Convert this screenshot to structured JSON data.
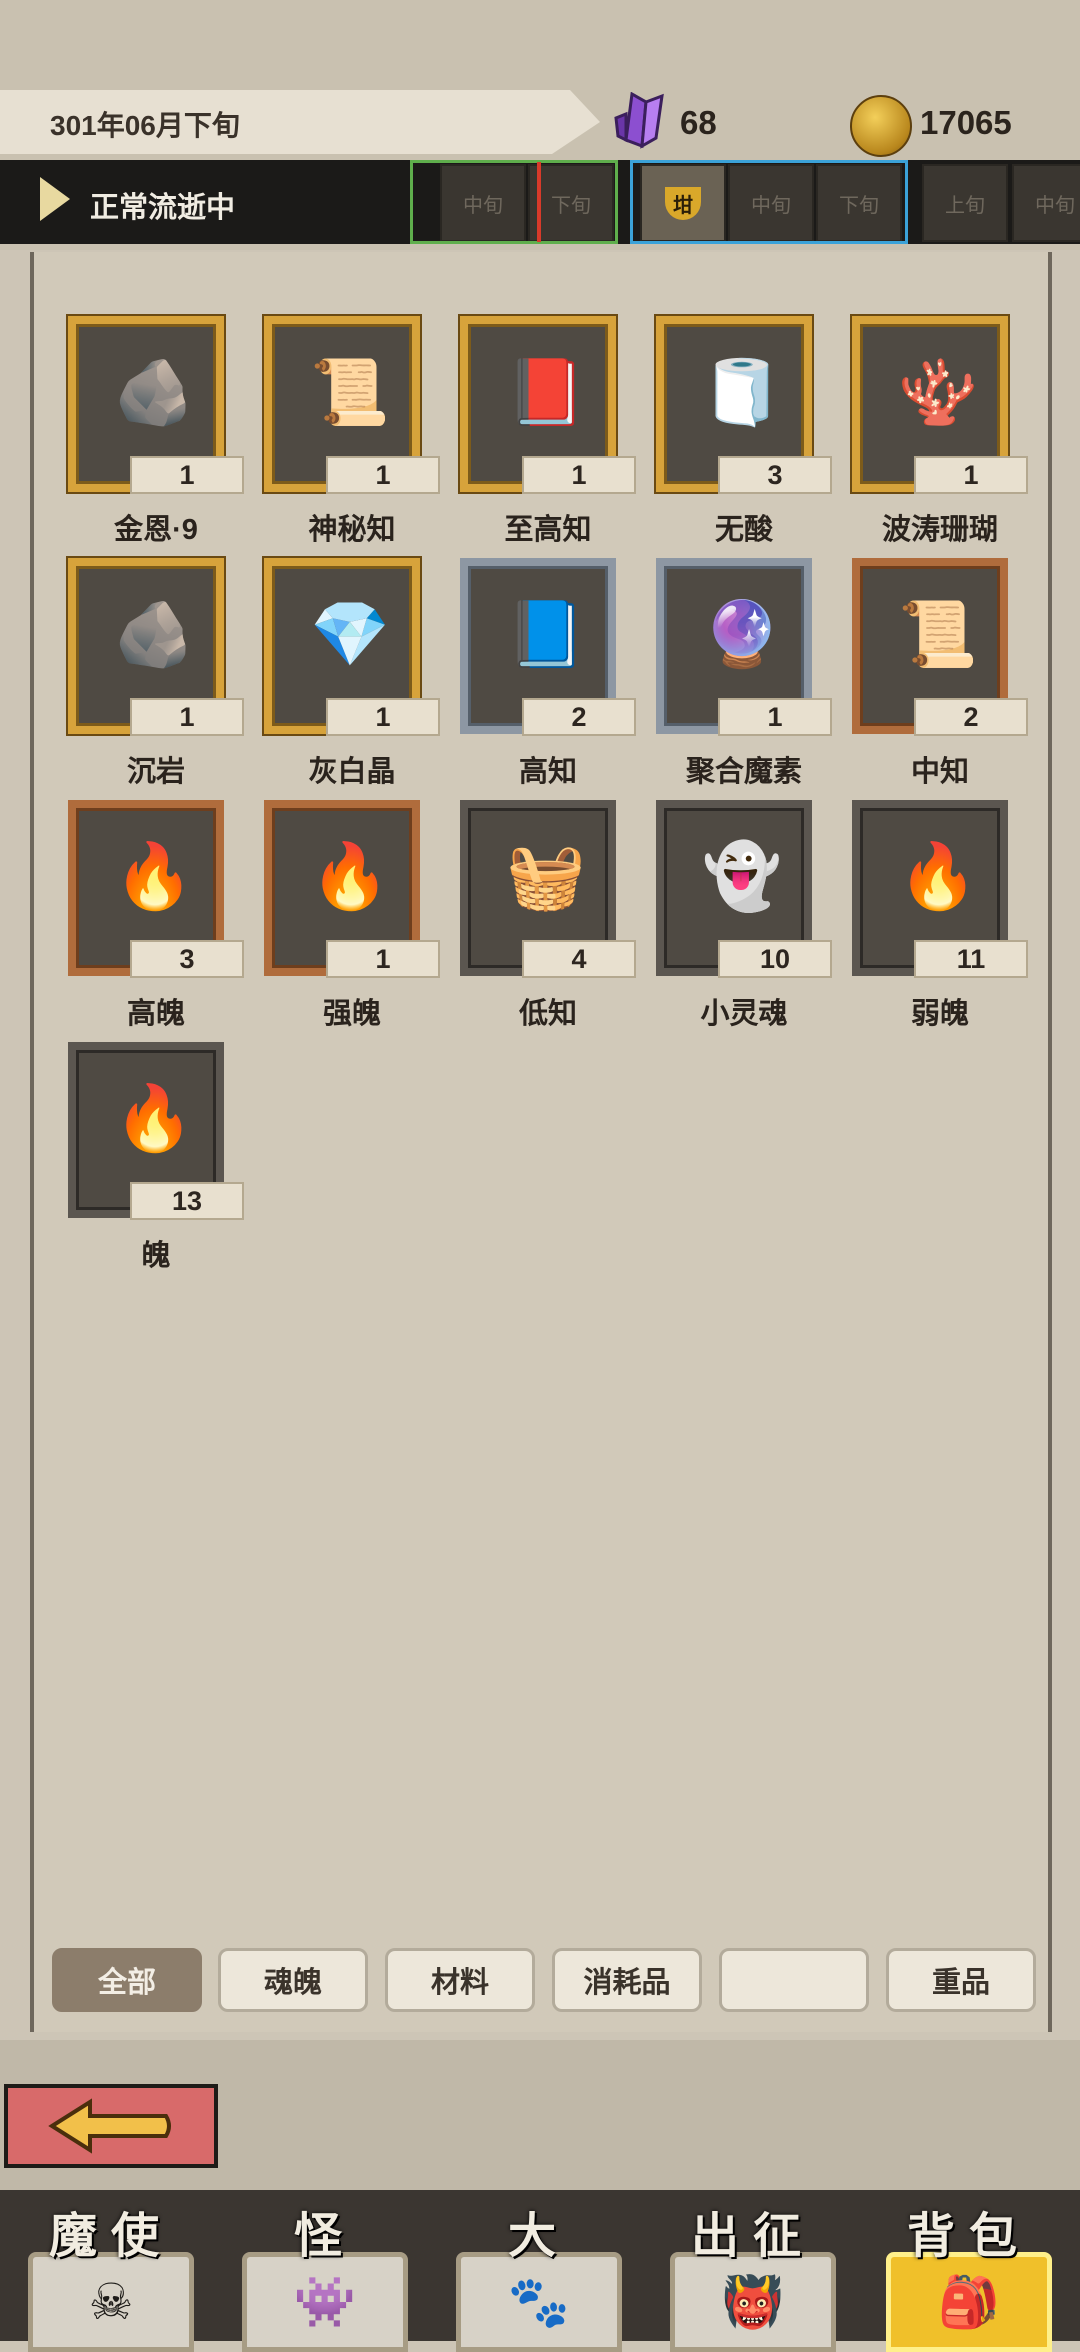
{
  "header": {
    "date": "301年06月下旬",
    "crystal_count": "68",
    "coin_count": "17065",
    "flow_status": "正常流逝中",
    "periods": [
      {
        "label": "中旬"
      },
      {
        "label": "下旬"
      },
      {
        "label": "坩"
      },
      {
        "label": "中旬"
      },
      {
        "label": "下旬"
      },
      {
        "label": "上旬"
      },
      {
        "label": "中旬"
      }
    ]
  },
  "inventory": {
    "items": [
      {
        "name": "金恩·9",
        "qty": "1",
        "rarity": "gold",
        "icon": "rune-stone-icon"
      },
      {
        "name": "神秘知",
        "qty": "1",
        "rarity": "gold",
        "icon": "tablet-icon"
      },
      {
        "name": "至高知",
        "qty": "1",
        "rarity": "gold",
        "icon": "tome-icon"
      },
      {
        "name": "无酸",
        "qty": "3",
        "rarity": "gold",
        "icon": "scroll-icon"
      },
      {
        "name": "波涛珊瑚",
        "qty": "1",
        "rarity": "gold",
        "icon": "coral-icon"
      },
      {
        "name": "沉岩",
        "qty": "1",
        "rarity": "gold",
        "icon": "rock-icon"
      },
      {
        "name": "灰白晶",
        "qty": "1",
        "rarity": "gold",
        "icon": "crystal-icon"
      },
      {
        "name": "高知",
        "qty": "2",
        "rarity": "silver",
        "icon": "book-icon"
      },
      {
        "name": "聚合魔素",
        "qty": "1",
        "rarity": "silver",
        "icon": "orb-icon"
      },
      {
        "name": "中知",
        "qty": "2",
        "rarity": "copper",
        "icon": "rolled-scroll-icon"
      },
      {
        "name": "高魄",
        "qty": "3",
        "rarity": "copper",
        "icon": "flame-icon"
      },
      {
        "name": "强魄",
        "qty": "1",
        "rarity": "copper",
        "icon": "flame-icon"
      },
      {
        "name": "低知",
        "qty": "4",
        "rarity": "plain",
        "icon": "bundle-icon"
      },
      {
        "name": "小灵魂",
        "qty": "10",
        "rarity": "plain",
        "icon": "spirit-icon"
      },
      {
        "name": "弱魄",
        "qty": "11",
        "rarity": "plain",
        "icon": "flame-icon"
      },
      {
        "name": "魄",
        "qty": "13",
        "rarity": "plain",
        "icon": "flame-icon"
      }
    ]
  },
  "tabs": [
    {
      "label": "全部",
      "active": true
    },
    {
      "label": "魂魄",
      "active": false
    },
    {
      "label": "材料",
      "active": false
    },
    {
      "label": "消耗品",
      "active": false
    },
    {
      "label": "",
      "active": false
    },
    {
      "label": "重品",
      "active": false
    }
  ],
  "bottom_nav": [
    {
      "label": "魔使",
      "icon": "skull-icon"
    },
    {
      "label": "怪",
      "icon": "monster-icon"
    },
    {
      "label": "大",
      "icon": "beast-icon"
    },
    {
      "label": "出征",
      "icon": "horned-face-icon"
    },
    {
      "label": "背包",
      "icon": "backpack-icon",
      "active": true
    }
  ],
  "colors": {
    "gold_frame": "#d7a33b",
    "silver_frame": "#8d97a3",
    "copper_frame": "#b06c3c",
    "active_nav": "#f0c02a",
    "back_button": "#d86a6a"
  }
}
